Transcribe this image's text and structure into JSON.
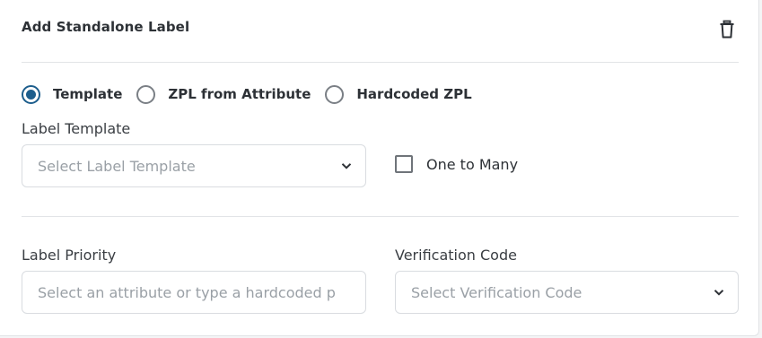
{
  "card": {
    "title": "Add Standalone Label",
    "delete_icon": "trash-icon"
  },
  "source_options": [
    {
      "label": "Template",
      "selected": true
    },
    {
      "label": "ZPL from Attribute",
      "selected": false
    },
    {
      "label": "Hardcoded ZPL",
      "selected": false
    }
  ],
  "label_template": {
    "label": "Label Template",
    "placeholder": "Select Label Template",
    "icon": "chevron-down-icon"
  },
  "one_to_many": {
    "label": "One to Many",
    "checked": false
  },
  "label_priority": {
    "label": "Label Priority",
    "placeholder": "Select an attribute or type a hardcoded p"
  },
  "verification_code": {
    "label": "Verification Code",
    "placeholder": "Select Verification Code",
    "icon": "chevron-down-icon"
  },
  "colors": {
    "accent": "#1c5d8c",
    "placeholder": "#9aa0a6",
    "border": "#d9dce0"
  }
}
